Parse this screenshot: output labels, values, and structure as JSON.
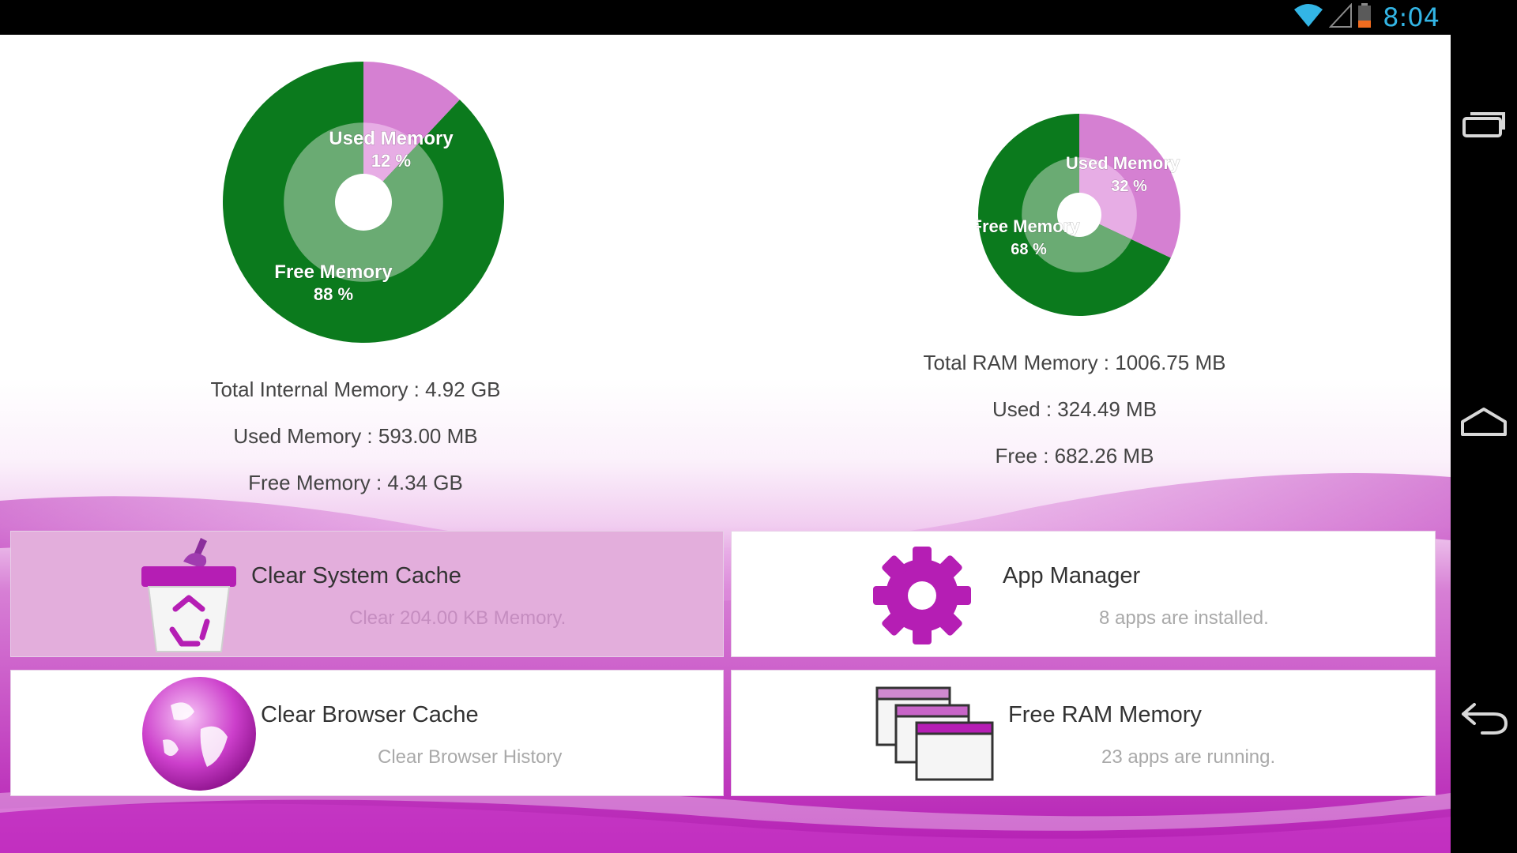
{
  "status_bar": {
    "time": "8:04",
    "icons": [
      "wifi-icon",
      "cell-signal-icon",
      "battery-low-icon"
    ],
    "time_color": "#33b5e5"
  },
  "nav_bar": {
    "icons": [
      "recent-apps-icon",
      "home-icon",
      "back-icon"
    ]
  },
  "internal_storage": {
    "chart": {
      "used_label": "Used Memory",
      "used_pct": "12 %",
      "free_label": "Free Memory",
      "free_pct": "88 %"
    },
    "total": "Total Internal Memory : 4.92 GB",
    "used": "Used Memory : 593.00 MB",
    "free": "Free Memory : 4.34 GB"
  },
  "ram": {
    "chart": {
      "used_label": "Used Memory",
      "used_pct": "32 %",
      "free_label": "Free Memory",
      "free_pct": "68 %"
    },
    "total": "Total RAM Memory : 1006.75 MB",
    "used": "Used : 324.49 MB",
    "free": "Free : 682.26 MB"
  },
  "colors": {
    "free": "#0b7a1d",
    "free_inner": "#6aab73",
    "used": "#d580d2",
    "used_inner": "#e7ade5",
    "accent": "#b51eb4"
  },
  "chart_data": [
    {
      "type": "pie",
      "slices": [
        {
          "label": "Used Memory",
          "value": 12
        },
        {
          "label": "Free Memory",
          "value": 88
        }
      ]
    },
    {
      "type": "pie",
      "slices": [
        {
          "label": "Used Memory",
          "value": 32
        },
        {
          "label": "Free Memory",
          "value": 68
        }
      ]
    }
  ],
  "tiles": {
    "system_cache": {
      "title": "Clear System Cache",
      "subtitle": "Clear 204.00 KB Memory.",
      "icon": "recycle-bin-icon"
    },
    "app_manager": {
      "title": "App Manager",
      "subtitle": "8 apps are installed.",
      "icon": "gear-icon"
    },
    "browser_cache": {
      "title": "Clear Browser Cache",
      "subtitle": "Clear Browser History",
      "icon": "globe-icon"
    },
    "free_ram": {
      "title": "Free RAM Memory",
      "subtitle": "23 apps are running.",
      "icon": "windows-stack-icon"
    }
  }
}
